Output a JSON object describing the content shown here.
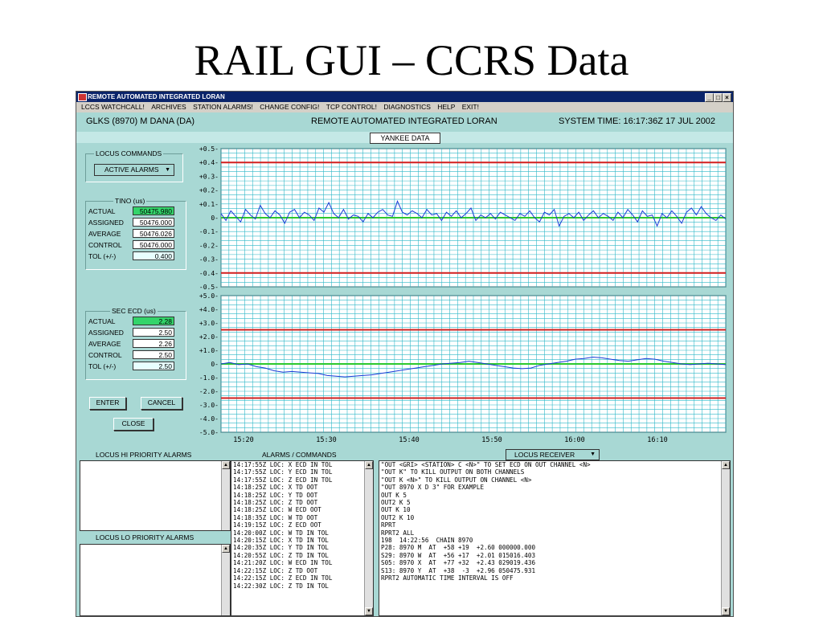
{
  "slide": {
    "title": "RAIL GUI – CCRS Data"
  },
  "window": {
    "title": "REMOTE AUTOMATED INTEGRATED LORAN",
    "controls": {
      "minimize": "_",
      "maximize": "□",
      "close": "×"
    }
  },
  "menu": [
    "LCCS WATCHCALL!",
    "ARCHIVES",
    "STATION ALARMS!",
    "CHANGE CONFIG!",
    "TCP CONTROL!",
    "DIAGNOSTICS",
    "HELP",
    "EXIT!"
  ],
  "info": {
    "station": "GLKS (8970)  M DANA (DA)",
    "app_name": "REMOTE AUTOMATED INTEGRATED LORAN",
    "system_time": "SYSTEM TIME: 16:17:36Z 17 JUL 2002"
  },
  "tab": {
    "label": "YANKEE DATA"
  },
  "locus_commands": {
    "group_label": "LOCUS COMMANDS",
    "select_value": "ACTIVE ALARMS"
  },
  "tino": {
    "group_label": "TINO (us)",
    "rows": [
      {
        "label": "ACTUAL",
        "value": "50475.980"
      },
      {
        "label": "ASSIGNED",
        "value": "50476.000"
      },
      {
        "label": "AVERAGE",
        "value": "50476.026"
      },
      {
        "label": "CONTROL",
        "value": "50476.000"
      },
      {
        "label": "TOL (+/-)",
        "value": "0.400"
      }
    ]
  },
  "sec_ecd": {
    "group_label": "SEC ECD (us)",
    "rows": [
      {
        "label": "ACTUAL",
        "value": "2.28"
      },
      {
        "label": "ASSIGNED",
        "value": "2.50"
      },
      {
        "label": "AVERAGE",
        "value": "2.26"
      },
      {
        "label": "CONTROL",
        "value": "2.50"
      },
      {
        "label": "TOL (+/-)",
        "value": "2.50"
      }
    ]
  },
  "buttons": {
    "enter": "ENTER",
    "cancel": "CANCEL",
    "close": "CLOSE"
  },
  "colors": {
    "trace": "#1a3bd6",
    "limit": "#d21f1f",
    "center": "#2ec82e",
    "grid": "#2fb8c8",
    "green_field": "#33d46a"
  },
  "chart_data": [
    {
      "type": "line",
      "title": "",
      "ylim": [
        -0.5,
        0.5
      ],
      "y_ticks": [
        "+0.5",
        "+0.4",
        "+0.3",
        "+0.2",
        "+0.1",
        "0",
        "-0.1",
        "-0.2",
        "-0.3",
        "-0.4",
        "-0.5"
      ],
      "limit_lines": [
        0.4,
        -0.4
      ],
      "center_line": 0,
      "series": [
        {
          "values": [
            0.03,
            -0.02,
            0.05,
            0.01,
            -0.03,
            0.06,
            0.02,
            -0.01,
            0.09,
            0.03,
            0.0,
            0.05,
            0.02,
            -0.04,
            0.04,
            0.06,
            0.0,
            0.04,
            0.02,
            -0.02,
            0.07,
            0.04,
            0.11,
            0.03,
            0.0,
            0.06,
            -0.01,
            0.02,
            0.01,
            -0.03,
            0.03,
            0.0,
            0.04,
            0.06,
            0.02,
            0.01,
            0.12,
            0.04,
            0.02,
            0.05,
            0.03,
            0.0,
            0.06,
            0.02,
            0.03,
            -0.02,
            0.04,
            0.01,
            0.05,
            0.0,
            0.03,
            0.07,
            -0.02,
            0.02,
            0.0,
            0.03,
            -0.01,
            0.04,
            0.02,
            0.0,
            -0.02,
            0.03,
            0.01,
            0.05,
            0.0,
            -0.03,
            0.04,
            0.02,
            0.06,
            -0.06,
            0.01,
            0.03,
            0.0,
            0.04,
            -0.02,
            0.02,
            0.05,
            0.0,
            0.03,
            0.01,
            -0.02,
            0.04,
            0.0,
            0.06,
            0.02,
            -0.03,
            0.05,
            0.01,
            0.02,
            -0.06,
            0.03,
            0.0,
            0.05,
            0.01,
            -0.04,
            0.04,
            0.07,
            0.02,
            0.08,
            0.03,
            0.0,
            -0.02,
            0.02,
            -0.01
          ]
        }
      ],
      "x_ticks": [
        "15:20",
        "15:30",
        "15:40",
        "15:50",
        "16:00",
        "16:10"
      ]
    },
    {
      "type": "line",
      "title": "",
      "ylim": [
        -5.0,
        5.0
      ],
      "y_ticks": [
        "+5.0",
        "+4.0",
        "+3.0",
        "+2.0",
        "+1.0",
        "0",
        "-1.0",
        "-2.0",
        "-3.0",
        "-4.0",
        "-5.0"
      ],
      "limit_lines": [
        2.5,
        -2.5
      ],
      "center_line": 0,
      "series": [
        {
          "values": [
            0.0,
            0.1,
            -0.05,
            0.0,
            -0.2,
            -0.3,
            -0.5,
            -0.6,
            -0.55,
            -0.6,
            -0.65,
            -0.7,
            -0.85,
            -0.9,
            -0.95,
            -0.9,
            -0.85,
            -0.8,
            -0.7,
            -0.6,
            -0.5,
            -0.4,
            -0.3,
            -0.2,
            -0.1,
            0.0,
            0.05,
            0.1,
            0.2,
            0.1,
            0.0,
            -0.1,
            -0.2,
            -0.3,
            -0.35,
            -0.3,
            -0.1,
            0.0,
            0.1,
            0.2,
            0.35,
            0.4,
            0.5,
            0.45,
            0.35,
            0.25,
            0.2,
            0.3,
            0.4,
            0.35,
            0.2,
            0.1,
            0.0,
            -0.05,
            0.0,
            0.05,
            0.0,
            -0.05
          ]
        }
      ],
      "x_ticks": [
        "15:20",
        "15:30",
        "15:40",
        "15:50",
        "16:00",
        "16:10"
      ]
    }
  ],
  "bottom": {
    "hi_label": "LOCUS HI PRIORITY ALARMS",
    "lo_label": "LOCUS LO PRIORITY ALARMS",
    "alarms_label": "ALARMS / COMMANDS",
    "receiver_select": "LOCUS RECEIVER",
    "alarm_lines": [
      "14:17:55Z LOC: X ECD IN TOL",
      "14:17:55Z LOC: Y ECD IN TOL",
      "14:17:55Z LOC: Z ECD IN TOL",
      "14:18:25Z LOC: X TD OOT",
      "14:18:25Z LOC: Y TD OOT",
      "14:18:25Z LOC: Z TD OOT",
      "14:18:25Z LOC: W ECD OOT",
      "14:18:35Z LOC: W TD OOT",
      "14:19:15Z LOC: Z ECD OOT",
      "14:20:00Z LOC: W TD IN TOL",
      "14:20:15Z LOC: X TD IN TOL",
      "14:20:35Z LOC: Y TD IN TOL",
      "14:20:55Z LOC: Z TD IN TOL",
      "14:21:20Z LOC: W ECD IN TOL",
      "14:22:15Z LOC: Z TD OOT",
      "14:22:15Z LOC: Z ECD IN TOL",
      "14:22:30Z LOC: Z TD IN TOL"
    ],
    "command_lines": [
      "\"OUT <GRI> <STATION> C <N>\" TO SET ECD ON OUT CHANNEL <N>",
      "\"OUT K\" TO KILL OUTPUT ON BOTH CHANNELS",
      "\"OUT K <N>\" TO KILL OUTPUT ON CHANNEL <N>",
      "\"OUT 8970 X D 3\" FOR EXAMPLE",
      "OUT K 5",
      "OUT2 K 5",
      "OUT K 10",
      "OUT2 K 10",
      "RPRT",
      "RPRT2 ALL",
      "198  14:22:56  CHAIN 8970",
      "P28: 8970 M  AT  +58 +19  +2.60 000000.000",
      "S29: 8970 W  AT  +56 +17  +2.01 015016.403",
      "S05: 8970 X  AT  +77 +32  +2.43 029019.436",
      "S13: 8970 Y  AT  +38  -3  +2.96 050475.931",
      "RPRT2 AUTOMATIC TIME INTERVAL IS OFF"
    ]
  }
}
